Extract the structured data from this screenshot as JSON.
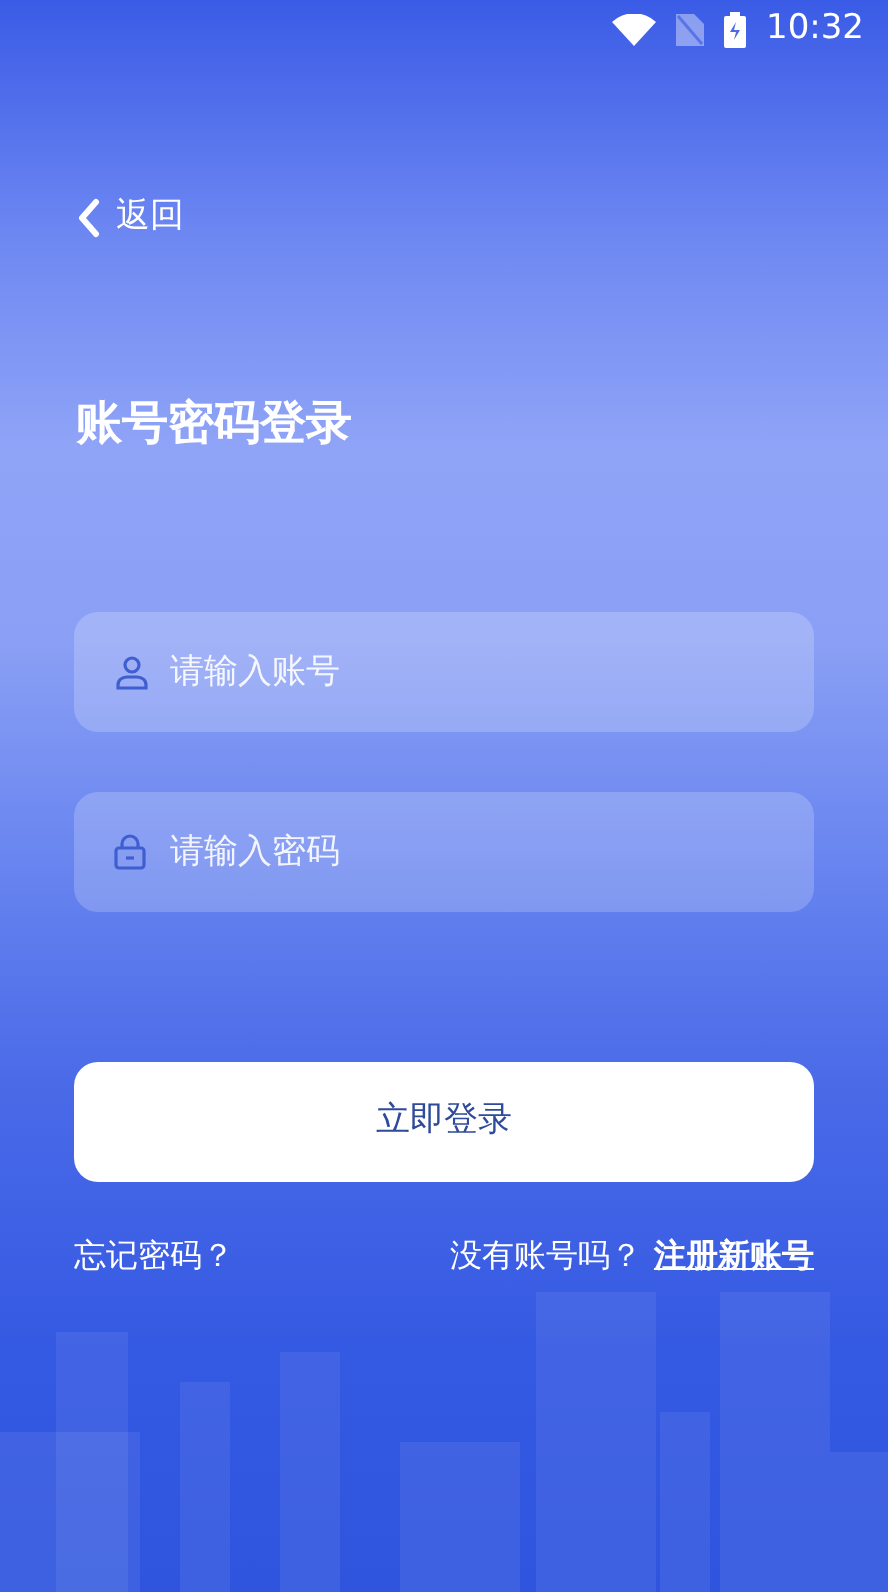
{
  "status_bar": {
    "time": "10:32"
  },
  "back": {
    "label": "返回"
  },
  "title": "账号密码登录",
  "fields": [
    {
      "kind": "user",
      "placeholder": "请输入账号"
    },
    {
      "kind": "lock",
      "placeholder": "请输入密码"
    }
  ],
  "login_button": "立即登录",
  "forgot_link": "忘记密码？",
  "register_prompt": "没有账号吗？",
  "register_link": "注册新账号"
}
